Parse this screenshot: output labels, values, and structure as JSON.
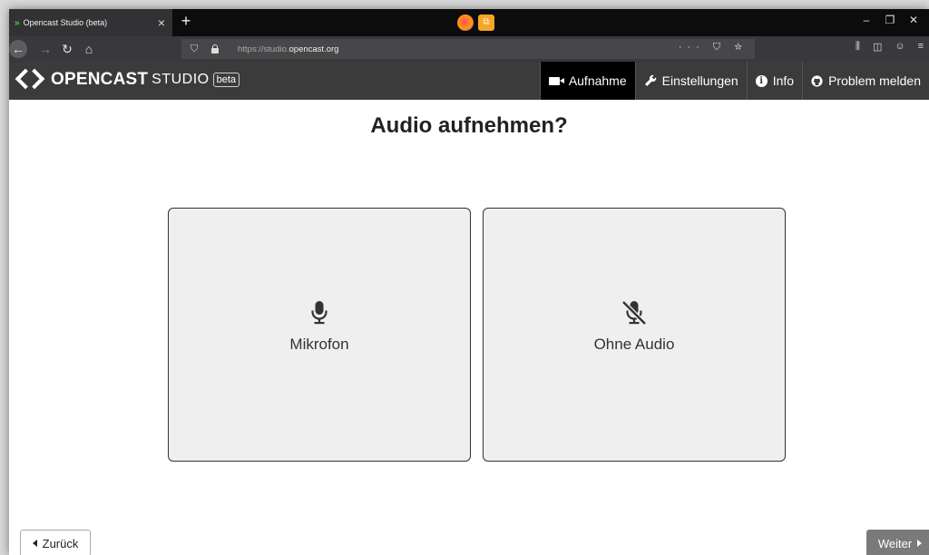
{
  "browser": {
    "tab_title": "Opencast Studio (beta)",
    "tab_close": "×",
    "new_tab": "+",
    "url_prefix": "https://studio.",
    "url_domain": "opencast.org",
    "window_controls": [
      "–",
      "❐",
      "✕"
    ]
  },
  "app": {
    "logo_word": "OPENCAST",
    "logo_studio": "STUDIO",
    "logo_beta": "beta",
    "nav": [
      {
        "label": "Aufnahme",
        "icon": "video-camera-icon",
        "active": true
      },
      {
        "label": "Einstellungen",
        "icon": "wrench-icon",
        "active": false
      },
      {
        "label": "Info",
        "icon": "info-circle-icon",
        "active": false
      },
      {
        "label": "Problem melden",
        "icon": "github-icon",
        "active": false
      }
    ]
  },
  "main": {
    "title": "Audio aufnehmen?",
    "options": [
      {
        "label": "Mikrofon",
        "icon": "microphone-icon"
      },
      {
        "label": "Ohne Audio",
        "icon": "microphone-slash-icon"
      }
    ],
    "back_label": "Zurück",
    "next_label": "Weiter"
  },
  "colors": {
    "header_bg": "#3b3b3b",
    "active_nav_bg": "#000000",
    "card_bg": "#efefef",
    "next_button_bg": "#7a7a7a"
  }
}
